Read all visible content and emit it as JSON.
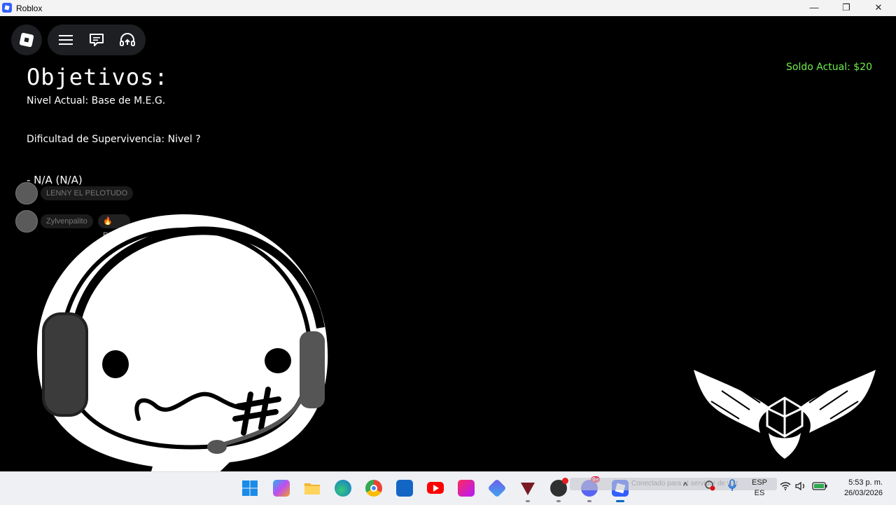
{
  "window": {
    "title": "Roblox",
    "minimize_glyph": "—",
    "restore_glyph": "❐",
    "close_glyph": "✕"
  },
  "hud": {
    "objectives_title": "Objetivos:",
    "current_level": "Nivel Actual: Base de M.E.G.",
    "difficulty": "Dificultad de Supervivencia: Nivel ?",
    "objective_item": "- N/A (N/A)",
    "balance": "Soldo Actual: $20",
    "balance_color": "#6ef04a"
  },
  "players": [
    {
      "name": "LENNY EL PELOTUDO",
      "badge": ""
    },
    {
      "name": "Zylvenpalito",
      "badge": "🔥 BROS"
    }
  ],
  "taskbar": {
    "apps": [
      "windows-start-icon",
      "copilot-icon",
      "file-explorer-icon",
      "edge-icon",
      "chrome-icon",
      "outlook-icon",
      "youtube-icon",
      "creative-cloud-icon",
      "office-icon",
      "game-launcher-icon",
      "obs-icon",
      "discord-icon",
      "roblox-icon"
    ],
    "discord_badge": "9+",
    "notification_text": "Conectado para el servidor de voz",
    "language_top": "ESP",
    "language_bottom": "ES",
    "time": "5:53 p. m.",
    "date": "26/03/2026"
  }
}
